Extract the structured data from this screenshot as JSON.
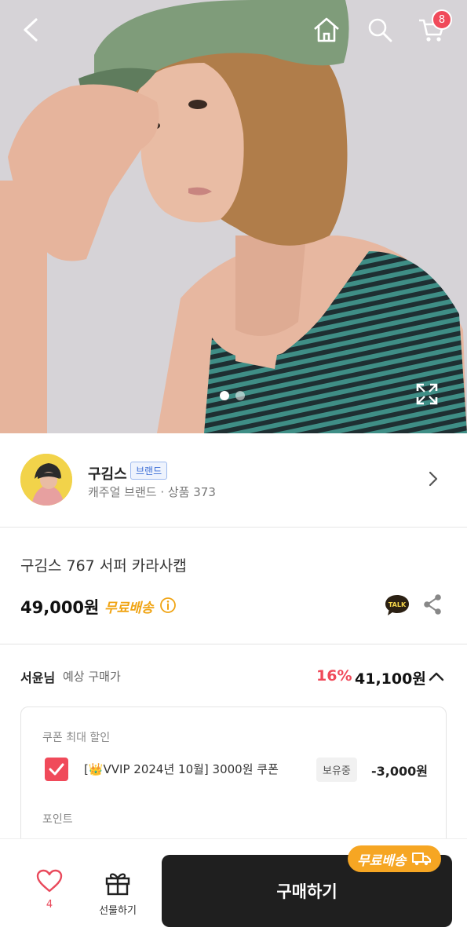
{
  "topbar": {
    "cart_count": "8"
  },
  "hero": {
    "slide_count": 2,
    "active_slide": 1
  },
  "brand": {
    "name": "구김스",
    "tag": "브랜드",
    "subtitle": "캐주얼 브랜드 · 상품 373"
  },
  "product": {
    "title": "구김스 767 서퍼 카라사캡",
    "price": "49,000원",
    "free_shipping": "무료배송",
    "talk_label": "TALK"
  },
  "estimate": {
    "user": "서윤님",
    "label": "예상 구매가",
    "discount_pct": "16%",
    "price": "41,100원"
  },
  "coupons": {
    "section_title": "쿠폰 최대 할인",
    "coupon_name": "[👑VVIP 2024년 10월] 3000원 쿠폰",
    "coupon_status": "보유중",
    "coupon_amount": "-3,000원",
    "checked": true,
    "points_title": "포인트"
  },
  "bottombar": {
    "like_count": "4",
    "gift_label": "선물하기",
    "buy_label": "구매하기",
    "ship_badge": "무료배송"
  },
  "colors": {
    "accent_red": "#f04a5a",
    "shipping_orange": "#f0a414",
    "buy_button": "#1f1f1f"
  }
}
